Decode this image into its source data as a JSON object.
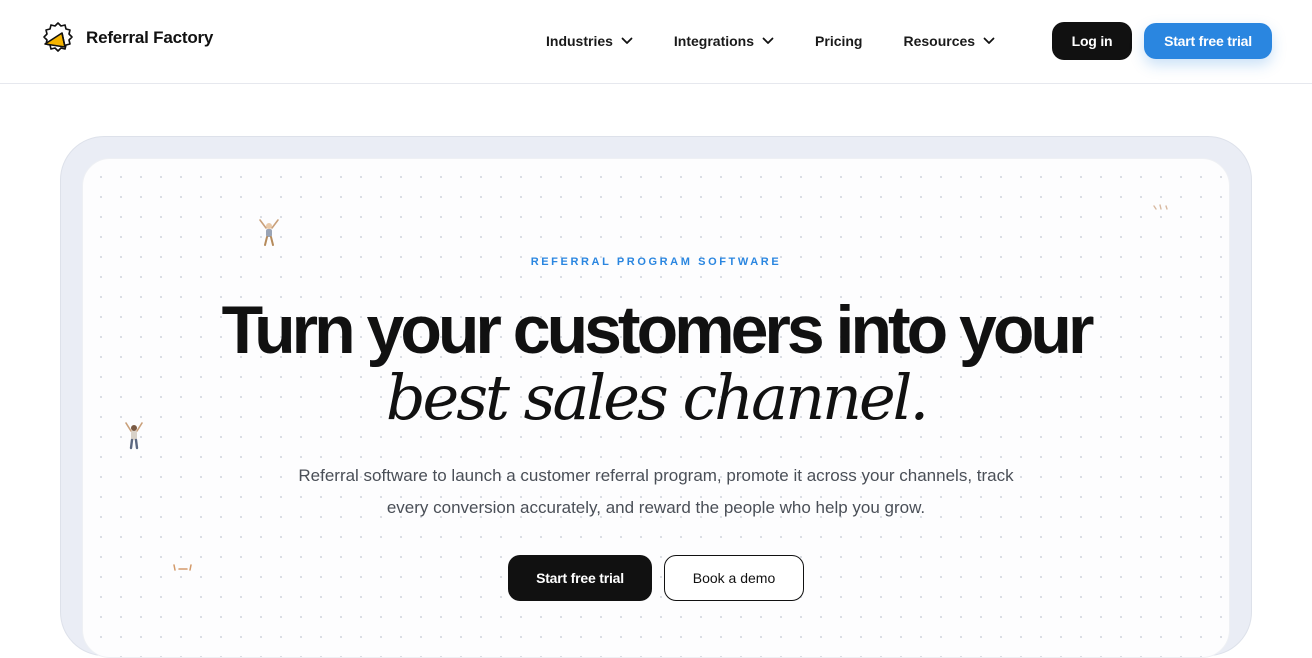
{
  "brand": {
    "name": "Referral Factory",
    "accent": "#2a86e0",
    "logo_color": "#f5b400"
  },
  "nav": {
    "items": [
      {
        "label": "Industries",
        "has_dropdown": true
      },
      {
        "label": "Integrations",
        "has_dropdown": true
      },
      {
        "label": "Pricing",
        "has_dropdown": false
      },
      {
        "label": "Resources",
        "has_dropdown": true
      }
    ],
    "login_label": "Log in",
    "trial_label": "Start free trial"
  },
  "hero": {
    "eyebrow": "REFERRAL PROGRAM SOFTWARE",
    "headline_line1": "Turn your customers into your",
    "headline_line2": "best sales channel.",
    "subtext_line1": "Referral software to launch a customer referral program, promote it across your channels, track",
    "subtext_line2": "every conversion accurately, and reward the people who help you grow.",
    "cta_primary": "Start free trial",
    "cta_secondary": "Book a demo"
  },
  "icons": {
    "logo": "referral-factory-logo-icon",
    "dropdown": "chevron-down-icon",
    "decorations": [
      "cheering-person-illustration",
      "jumping-person-illustration",
      "confetti-illustration"
    ]
  }
}
